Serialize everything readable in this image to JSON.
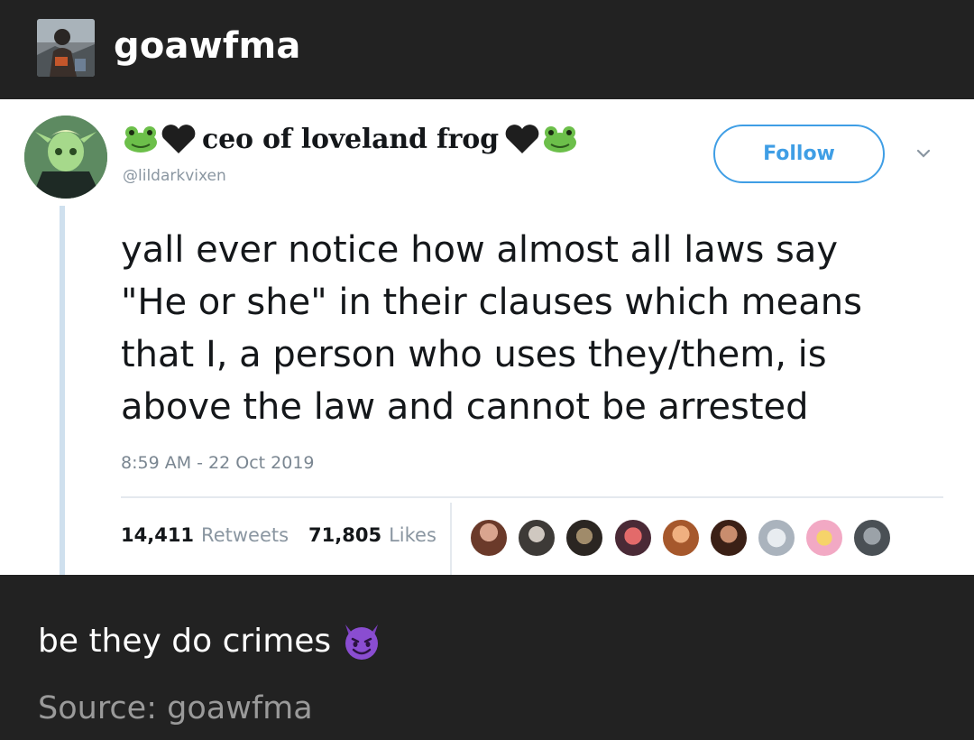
{
  "header": {
    "blog_name": "goawfma",
    "avatar_icon": "blog-avatar"
  },
  "tweet": {
    "display_name": "ceo of loveland frog",
    "name_decorations": [
      "frog-emoji",
      "black-heart-emoji",
      "black-heart-emoji",
      "frog-emoji"
    ],
    "handle": "@lildarkvixen",
    "follow_label": "Follow",
    "text_lines": [
      "yall ever notice how almost all laws say",
      "\"He or she\" in their clauses which means",
      "that I, a person who uses they/them, is",
      "above the law and cannot be arrested"
    ],
    "timestamp": "8:59 AM - 22 Oct 2019",
    "retweets_count": "14,411",
    "retweets_label": "Retweets",
    "likes_count": "71,805",
    "likes_label": "Likes",
    "liker_avatar_count": 9
  },
  "caption": {
    "text": "be they do crimes",
    "emoji": "smiling-devil-emoji"
  },
  "source": {
    "text": "Source: goawfma"
  },
  "colors": {
    "background": "#222222",
    "card": "#ffffff",
    "accent": "#3f9ee5",
    "muted": "#8a96a1",
    "devil_purple": "#7b3fbf"
  }
}
